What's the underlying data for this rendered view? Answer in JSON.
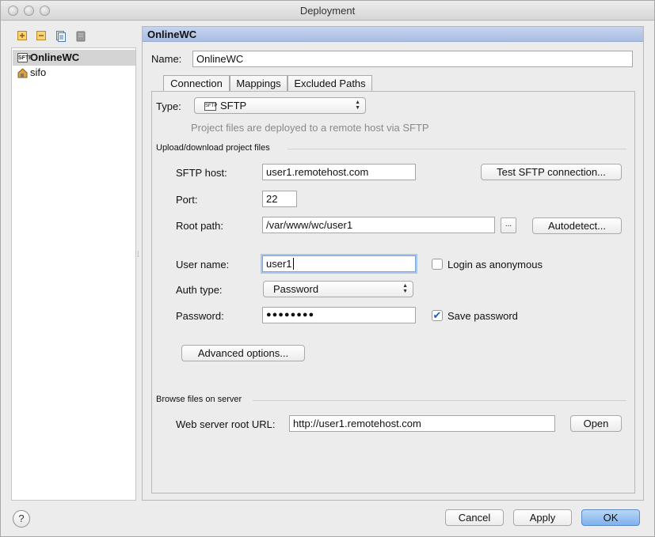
{
  "window": {
    "title": "Deployment"
  },
  "toolbar": {
    "add_icon": "add-icon",
    "remove_icon": "remove-icon",
    "copy_icon": "copy-icon",
    "default_icon": "server-icon"
  },
  "sidebar": {
    "items": [
      {
        "label": "OnlineWC",
        "icon": "sftp-icon",
        "icon_text": "SFTP",
        "selected": true
      },
      {
        "label": "sifo",
        "icon": "local-server-icon",
        "selected": false
      }
    ]
  },
  "panel": {
    "header": "OnlineWC",
    "name_label": "Name:",
    "name_value": "OnlineWC",
    "tabs": [
      {
        "label": "Connection"
      },
      {
        "label": "Mappings"
      },
      {
        "label": "Excluded Paths"
      }
    ],
    "active_tab": "Connection"
  },
  "connection": {
    "type_label": "Type:",
    "type_icon_text": "SFTP",
    "type_value": "SFTP",
    "type_hint": "Project files are deployed to a remote host via SFTP",
    "upload_section": "Upload/download project files",
    "sftp_host_label": "SFTP host:",
    "sftp_host_value": "user1.remotehost.com",
    "test_button": "Test SFTP connection...",
    "port_label": "Port:",
    "port_value": "22",
    "root_path_label": "Root path:",
    "root_path_value": "/var/www/wc/user1",
    "browse_button": "...",
    "autodetect_button": "Autodetect...",
    "user_name_label": "User name:",
    "user_name_value": "user1",
    "anonymous_label": "Login as anonymous",
    "anonymous_checked": false,
    "auth_type_label": "Auth type:",
    "auth_type_value": "Password",
    "password_label": "Password:",
    "password_value": "●●●●●●●●",
    "save_password_label": "Save password",
    "save_password_checked": true,
    "check_mark": "✔",
    "advanced_button": "Advanced options...",
    "browse_section": "Browse files on server",
    "web_root_label": "Web server root URL:",
    "web_root_value": "http://user1.remotehost.com",
    "open_button": "Open"
  },
  "footer": {
    "help": "?",
    "cancel": "Cancel",
    "apply": "Apply",
    "ok": "OK"
  },
  "colors": {
    "header_bg": "#b4c6e8",
    "primary_button": "#7eb2ed",
    "selection": "#d4d4d4"
  }
}
